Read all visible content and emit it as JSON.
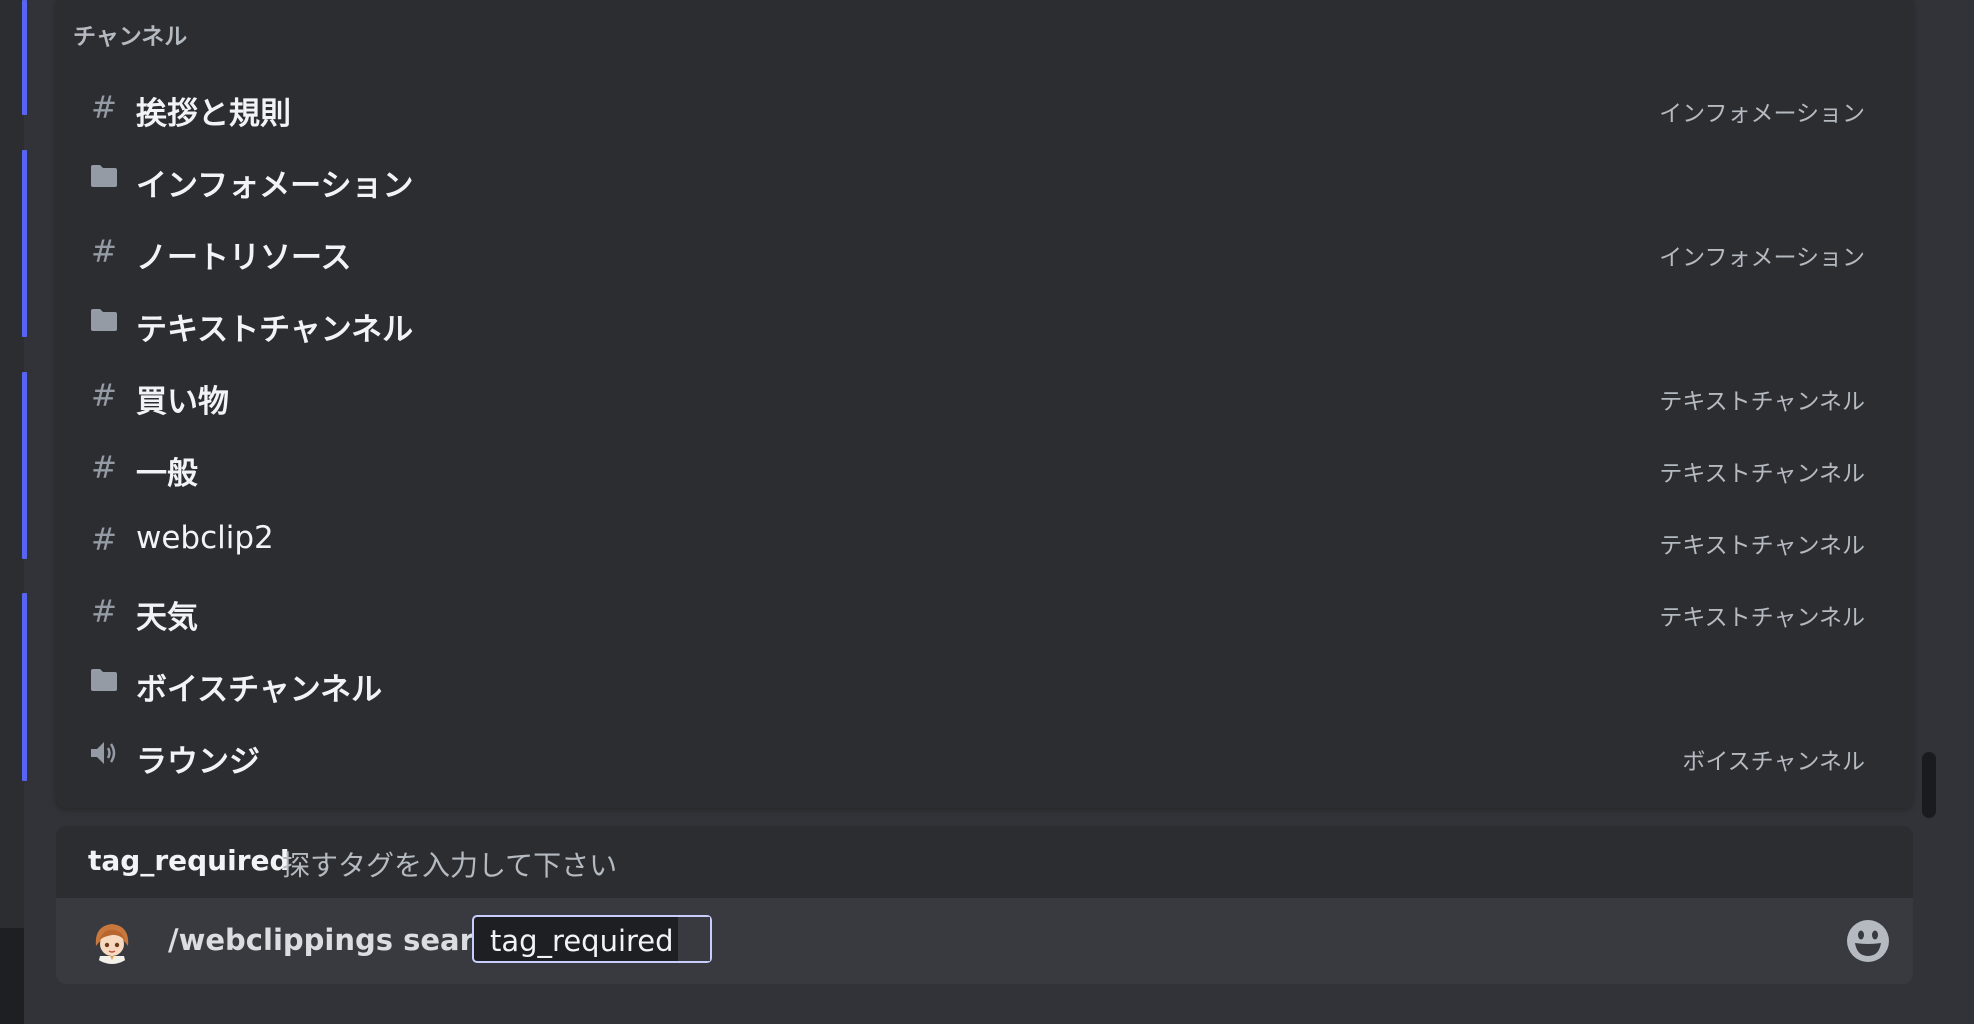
{
  "autocomplete": {
    "section_title": "チャンネル",
    "items": [
      {
        "type": "text-channel",
        "icon": "hashtag-icon",
        "label": "挨拶と規則",
        "category": "インフォメーション"
      },
      {
        "type": "category",
        "icon": "folder-icon",
        "label": "インフォメーション",
        "category": ""
      },
      {
        "type": "text-channel",
        "icon": "hashtag-icon",
        "label": "ノートリソース",
        "category": "インフォメーション"
      },
      {
        "type": "category",
        "icon": "folder-icon",
        "label": "テキストチャンネル",
        "category": ""
      },
      {
        "type": "text-channel",
        "icon": "hashtag-icon",
        "label": "買い物",
        "category": "テキストチャンネル"
      },
      {
        "type": "text-channel",
        "icon": "hashtag-icon",
        "label": "一般",
        "category": "テキストチャンネル"
      },
      {
        "type": "text-channel",
        "icon": "hashtag-icon",
        "label": "webclip2",
        "category": "テキストチャンネル"
      },
      {
        "type": "text-channel",
        "icon": "hashtag-icon",
        "label": "天気",
        "category": "テキストチャンネル"
      },
      {
        "type": "category",
        "icon": "folder-icon",
        "label": "ボイスチャンネル",
        "category": ""
      },
      {
        "type": "voice-channel",
        "icon": "speaker-icon",
        "label": "ラウンジ",
        "category": "ボイスチャンネル"
      }
    ]
  },
  "option_hint": {
    "name": "tag_required",
    "description": "探すタグを入力して下さい"
  },
  "composer": {
    "command": "/webclippings search",
    "param_value": "tag_required",
    "emoji_icon": "smiley-face-icon"
  },
  "colors": {
    "accent": "#5865f2",
    "background": "#313338",
    "popup": "#2b2d31"
  }
}
